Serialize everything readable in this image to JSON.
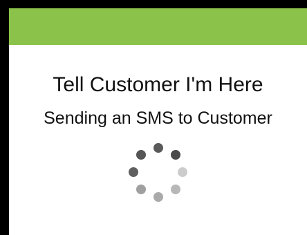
{
  "header": {
    "bar_color": "#8bc34a"
  },
  "main": {
    "title": "Tell Customer I'm Here",
    "subtitle": "Sending an SMS to Customer"
  },
  "spinner": {
    "icon": "loading-spinner-icon",
    "dot_colors": [
      "#5a5a5a",
      "#4a4a4a",
      "#cccccc",
      "#b8b8b8",
      "#aaaaaa",
      "#a0a0a0",
      "#606060",
      "#555555"
    ]
  }
}
